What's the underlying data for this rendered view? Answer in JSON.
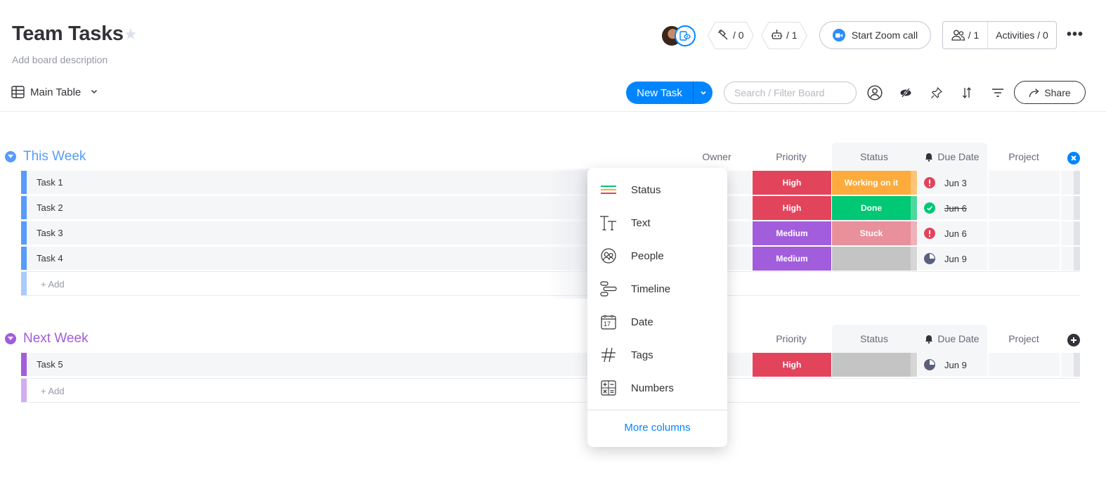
{
  "board": {
    "title": "Team Tasks",
    "description_placeholder": "Add board description",
    "favorite_icon": "star-icon"
  },
  "header": {
    "integrations_count": "/ 0",
    "automations_count": "/ 1",
    "zoom_label": "Start Zoom call",
    "members_count": "/ 1",
    "activities_label": "Activities / 0",
    "more_icon": "•••"
  },
  "toolbar": {
    "view_label": "Main Table",
    "new_task_label": "New Task",
    "search_placeholder": "Search / Filter Board",
    "share_label": "Share"
  },
  "columns": {
    "owner": "Owner",
    "owner_partial": "r",
    "priority": "Priority",
    "status": "Status",
    "due_date": "Due Date",
    "project": "Project"
  },
  "groups": [
    {
      "title": "This Week",
      "color": "#579bfc",
      "add_label": "+ Add",
      "rows": [
        {
          "name": "Task 1",
          "priority": "High",
          "priority_color": "#e2445c",
          "status": "Working on it",
          "status_color": "#fdab3d",
          "due": "Jun 3",
          "due_state": "overdue"
        },
        {
          "name": "Task 2",
          "priority": "High",
          "priority_color": "#e2445c",
          "status": "Done",
          "status_color": "#00c875",
          "due": "Jun 6",
          "due_state": "done"
        },
        {
          "name": "Task 3",
          "priority": "Medium",
          "priority_color": "#a25ddc",
          "status": "Stuck",
          "status_color": "#e8909c",
          "due": "Jun 6",
          "due_state": "overdue"
        },
        {
          "name": "Task 4",
          "priority": "Medium",
          "priority_color": "#a25ddc",
          "status": "",
          "status_color": "#c4c4c4",
          "due": "Jun 9",
          "due_state": "upcoming"
        }
      ]
    },
    {
      "title": "Next Week",
      "color": "#a25ddc",
      "add_label": "+ Add",
      "rows": [
        {
          "name": "Task 5",
          "priority": "High",
          "priority_color": "#e2445c",
          "status": "",
          "status_color": "#c4c4c4",
          "due": "Jun 9",
          "due_state": "upcoming"
        }
      ]
    }
  ],
  "column_menu": {
    "items": [
      {
        "label": "Status",
        "icon": "status-icon"
      },
      {
        "label": "Text",
        "icon": "text-icon"
      },
      {
        "label": "People",
        "icon": "people-icon"
      },
      {
        "label": "Timeline",
        "icon": "timeline-icon"
      },
      {
        "label": "Date",
        "icon": "calendar-icon",
        "icon_text": "17"
      },
      {
        "label": "Tags",
        "icon": "hashtag-icon"
      },
      {
        "label": "Numbers",
        "icon": "numbers-icon"
      }
    ],
    "more_label": "More columns"
  }
}
